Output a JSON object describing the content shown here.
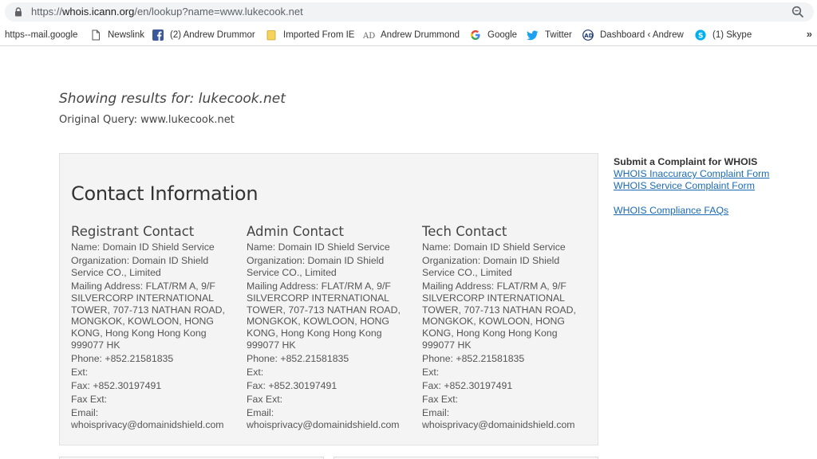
{
  "browser": {
    "url_scheme": "https://",
    "url_host": "whois.icann.org",
    "url_path": "/en/lookup?name=www.lukecook.net"
  },
  "bookmarks": [
    {
      "label": "https--mail.google",
      "icon": "none"
    },
    {
      "label": "Newslink",
      "icon": "page-icon"
    },
    {
      "label": "(2) Andrew Drummor",
      "icon": "facebook-icon"
    },
    {
      "label": "Imported From IE",
      "icon": "folder-icon"
    },
    {
      "label": "Andrew Drummond",
      "icon": "ad-icon"
    },
    {
      "label": "Google",
      "icon": "google-icon"
    },
    {
      "label": "Twitter",
      "icon": "twitter-icon"
    },
    {
      "label": "Dashboard ‹ Andrew",
      "icon": "dashboard-icon"
    },
    {
      "label": "(1) Skype",
      "icon": "skype-icon"
    }
  ],
  "page": {
    "showing_results": "Showing results for: lukecook.net",
    "original_query": "Original Query: www.lukecook.net",
    "contact_title": "Contact Information"
  },
  "contacts": [
    {
      "heading": "Registrant Contact",
      "name": "Name: Domain ID Shield Service",
      "organization": "Organization: Domain ID Shield Service CO., Limited",
      "address": "Mailing Address: FLAT/RM A, 9/F SILVERCORP INTERNATIONAL TOWER, 707-713 NATHAN ROAD, MONGKOK, KOWLOON, HONG KONG, Hong Kong Hong Kong 999077 HK",
      "phone": "Phone: +852.21581835",
      "ext": "Ext:",
      "fax": "Fax: +852.30197491",
      "fax_ext": "Fax Ext:",
      "email": "Email: whoisprivacy@domainidshield.com"
    },
    {
      "heading": "Admin Contact",
      "name": "Name: Domain ID Shield Service",
      "organization": "Organization: Domain ID Shield Service CO., Limited",
      "address": "Mailing Address: FLAT/RM A, 9/F SILVERCORP INTERNATIONAL TOWER, 707-713 NATHAN ROAD, MONGKOK, KOWLOON, HONG KONG, Hong Kong Hong Kong 999077 HK",
      "phone": "Phone: +852.21581835",
      "ext": "Ext:",
      "fax": "Fax: +852.30197491",
      "fax_ext": "Fax Ext:",
      "email": "Email: whoisprivacy@domainidshield.com"
    },
    {
      "heading": "Tech Contact",
      "name": "Name: Domain ID Shield Service",
      "organization": "Organization: Domain ID Shield Service CO., Limited",
      "address": "Mailing Address: FLAT/RM A, 9/F SILVERCORP INTERNATIONAL TOWER, 707-713 NATHAN ROAD, MONGKOK, KOWLOON, HONG KONG, Hong Kong Hong Kong 999077 HK",
      "phone": "Phone: +852.21581835",
      "ext": "Ext:",
      "fax": "Fax: +852.30197491",
      "fax_ext": "Fax Ext:",
      "email": "Email: whoisprivacy@domainidshield.com"
    }
  ],
  "sidebar": {
    "title": "Submit a Complaint for WHOIS",
    "link_inaccuracy": "WHOIS Inaccuracy Complaint Form",
    "link_service": "WHOIS Service Complaint Form",
    "link_faqs": "WHOIS Compliance FAQs"
  },
  "colors": {
    "link": "#1a6bb3",
    "panel_bg": "#f4f4f4",
    "twitter": "#1da1f2",
    "facebook": "#3b5998",
    "skype": "#00aff0"
  }
}
